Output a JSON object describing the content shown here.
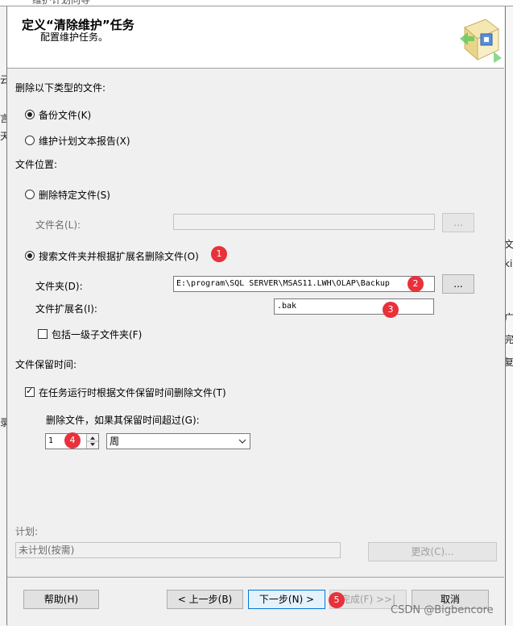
{
  "window_title": "维护计划向导",
  "header": {
    "title": "定义“清除维护”任务",
    "subtitle": "配置维护任务。"
  },
  "background_fragments": [
    "云",
    "言",
    "天",
    "录",
    "ki",
    "广",
    "完",
    "复",
    "文"
  ],
  "file_type": {
    "label": "删除以下类型的文件:",
    "options": [
      {
        "label": "备份文件(K)",
        "selected": true
      },
      {
        "label": "维护计划文本报告(X)",
        "selected": false
      }
    ]
  },
  "location": {
    "label": "文件位置:",
    "specific_file": {
      "label": "删除特定文件(S)",
      "selected": false
    },
    "file_name_label": "文件名(L):",
    "file_name_value": "",
    "browse_label": "...",
    "search_folder": {
      "label": "搜索文件夹并根据扩展名删除文件(O)",
      "selected": true
    },
    "folder_label": "文件夹(D):",
    "folder_value": "E:\\program\\SQL SERVER\\MSAS11.LWH\\OLAP\\Backup",
    "extension_label": "文件扩展名(I):",
    "extension_value": ".bak",
    "include_subfolders": {
      "label": "包括一级子文件夹(F)",
      "checked": false
    }
  },
  "retention": {
    "label": "文件保留时间:",
    "delete_by_age": {
      "label": "在任务运行时根据文件保留时间删除文件(T)",
      "checked": true
    },
    "older_than_label": "删除文件，如果其保留时间超过(G):",
    "amount": "1",
    "unit": "周"
  },
  "schedule": {
    "label": "计划:",
    "value": "未计划(按需)",
    "change_label": "更改(C)..."
  },
  "footer": {
    "help": "帮助(H)",
    "back": "< 上一步(B)",
    "next": "下一步(N) >",
    "finish": "完成(F) >>|",
    "cancel": "取消"
  },
  "badges": [
    "1",
    "2",
    "3",
    "4",
    "5"
  ],
  "watermark": "CSDN @Bigbencore",
  "colors": {
    "badge": "#e8313b",
    "focus_border": "#0078d7"
  }
}
